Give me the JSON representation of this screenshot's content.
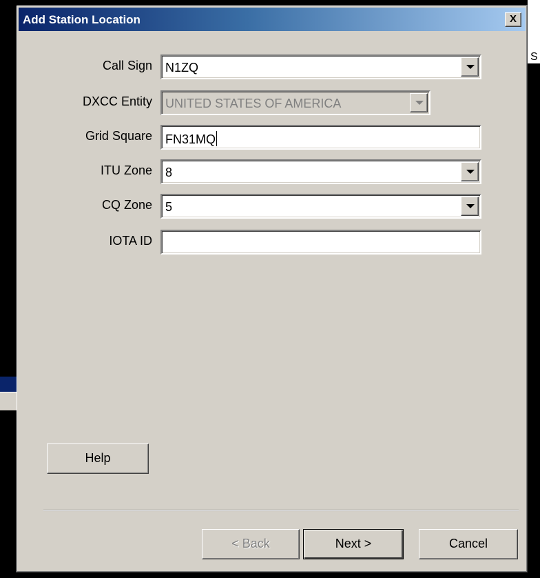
{
  "window": {
    "title": "Add Station Location",
    "close_label": "X"
  },
  "background": {
    "right_glyph": "S"
  },
  "form": {
    "call_sign": {
      "label": "Call Sign",
      "value": "N1ZQ"
    },
    "dxcc_entity": {
      "label": "DXCC Entity",
      "value": "UNITED STATES OF AMERICA"
    },
    "grid_square": {
      "label": "Grid Square",
      "value": "FN31MQ"
    },
    "itu_zone": {
      "label": "ITU Zone",
      "value": "8"
    },
    "cq_zone": {
      "label": "CQ Zone",
      "value": "5"
    },
    "iota_id": {
      "label": "IOTA ID",
      "value": ""
    }
  },
  "buttons": {
    "help": "Help",
    "back": "< Back",
    "next": "Next >",
    "cancel": "Cancel"
  },
  "icons": {
    "close": "close-icon",
    "dropdown": "chevron-down-icon"
  },
  "colors": {
    "titlebar": "#0a246a",
    "face": "#d4d0c8"
  }
}
